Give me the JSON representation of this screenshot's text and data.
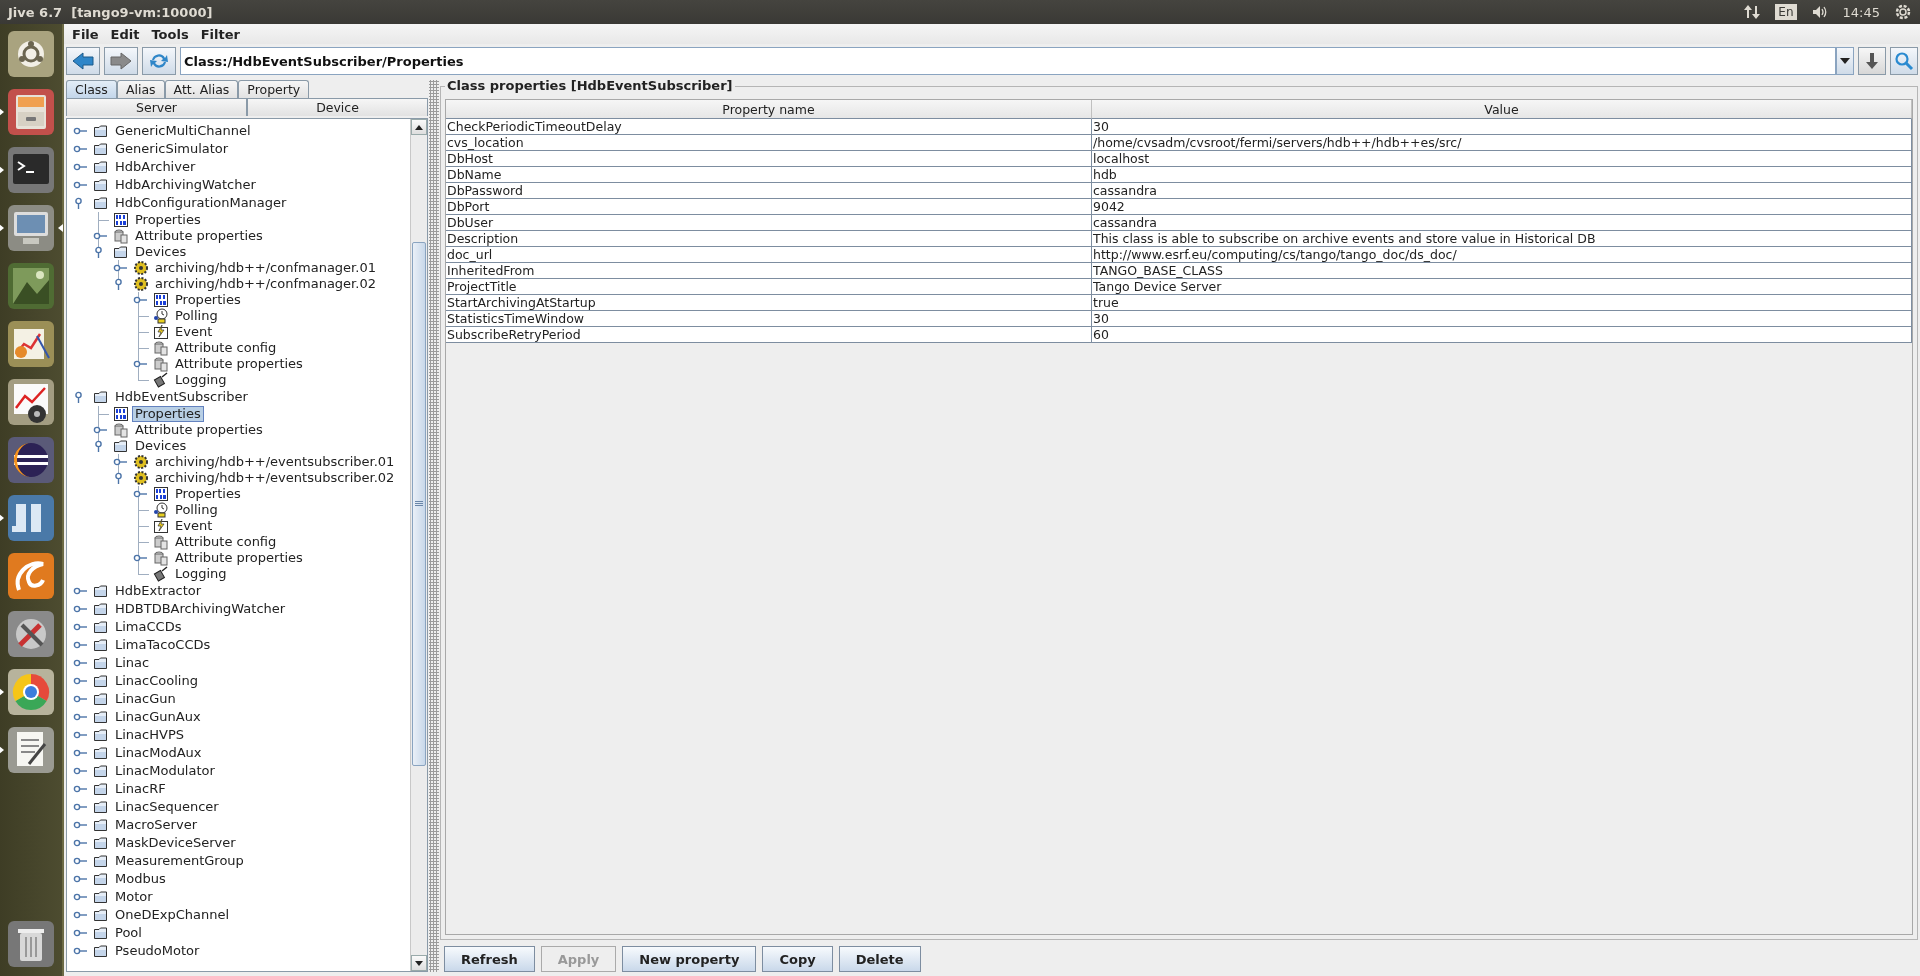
{
  "window": {
    "title": "Jive 6.7  [tango9-vm:10000]"
  },
  "panel": {
    "keyboard_layout": "En",
    "clock": "14:45"
  },
  "launcher": [
    {
      "kind": "ubuntu",
      "running": false,
      "focused": false
    },
    {
      "kind": "files",
      "running": true,
      "focused": false
    },
    {
      "kind": "terminal",
      "running": true,
      "focused": false
    },
    {
      "kind": "monitor",
      "running": true,
      "focused": true
    },
    {
      "kind": "photo",
      "running": false,
      "focused": false
    },
    {
      "kind": "chart",
      "running": false,
      "focused": false
    },
    {
      "kind": "media",
      "running": false,
      "focused": false
    },
    {
      "kind": "eclipse",
      "running": false,
      "focused": false
    },
    {
      "kind": "jive",
      "running": true,
      "focused": false
    },
    {
      "kind": "swirl",
      "running": false,
      "focused": false
    },
    {
      "kind": "tools",
      "running": false,
      "focused": false
    },
    {
      "kind": "browser",
      "running": true,
      "focused": false
    },
    {
      "kind": "editor",
      "running": true,
      "focused": false
    },
    {
      "kind": "trash",
      "running": false,
      "focused": false
    }
  ],
  "menu": [
    "File",
    "Edit",
    "Tools",
    "Filter"
  ],
  "nav_buttons": [
    {
      "kind": "back",
      "disabled": false
    },
    {
      "kind": "forward",
      "disabled": true
    },
    {
      "kind": "refresh",
      "disabled": false
    }
  ],
  "address": "Class:/HdbEventSubscriber/Properties",
  "tabs": {
    "top_row": [
      {
        "label": "Class",
        "selected": true
      },
      {
        "label": "Alias",
        "selected": false
      },
      {
        "label": "Att. Alias",
        "selected": false
      },
      {
        "label": "Property",
        "selected": false
      }
    ],
    "bottom_row": [
      {
        "label": "Server",
        "selected": false
      },
      {
        "label": "Device",
        "selected": false
      }
    ]
  },
  "tree": {
    "items": [
      {
        "label": "GenericMultiChannel",
        "kind": "folder",
        "expanded": false,
        "selected": false
      },
      {
        "label": "GenericSimulator",
        "kind": "folder",
        "expanded": false,
        "selected": false
      },
      {
        "label": "HdbArchiver",
        "kind": "folder",
        "expanded": false,
        "selected": false
      },
      {
        "label": "HdbArchivingWatcher",
        "kind": "folder",
        "expanded": false,
        "selected": false
      },
      {
        "label": "HdbConfigurationManager",
        "kind": "folder",
        "expanded": true,
        "selected": false,
        "children": [
          {
            "label": "Properties",
            "kind": "properties",
            "selected": false
          },
          {
            "label": "Attribute properties",
            "kind": "attributes",
            "expanded": false,
            "selected": false
          },
          {
            "label": "Devices",
            "kind": "folder",
            "expanded": true,
            "selected": false,
            "children": [
              {
                "label": "archiving/hdb++/confmanager.01",
                "kind": "device",
                "expanded": false,
                "selected": false
              },
              {
                "label": "archiving/hdb++/confmanager.02",
                "kind": "device",
                "expanded": true,
                "selected": false,
                "children": [
                  {
                    "label": "Properties",
                    "kind": "properties",
                    "expanded": false,
                    "selected": false
                  },
                  {
                    "label": "Polling",
                    "kind": "polling",
                    "selected": false
                  },
                  {
                    "label": "Event",
                    "kind": "event",
                    "selected": false
                  },
                  {
                    "label": "Attribute config",
                    "kind": "attributes",
                    "selected": false
                  },
                  {
                    "label": "Attribute properties",
                    "kind": "attributes",
                    "expanded": false,
                    "selected": false
                  },
                  {
                    "label": "Logging",
                    "kind": "logging",
                    "selected": false
                  }
                ]
              }
            ]
          }
        ]
      },
      {
        "label": "HdbEventSubscriber",
        "kind": "folder",
        "expanded": true,
        "selected": false,
        "children": [
          {
            "label": "Properties",
            "kind": "properties",
            "selected": true
          },
          {
            "label": "Attribute properties",
            "kind": "attributes",
            "expanded": false,
            "selected": false
          },
          {
            "label": "Devices",
            "kind": "folder",
            "expanded": true,
            "selected": false,
            "children": [
              {
                "label": "archiving/hdb++/eventsubscriber.01",
                "kind": "device",
                "expanded": false,
                "selected": false
              },
              {
                "label": "archiving/hdb++/eventsubscriber.02",
                "kind": "device",
                "expanded": true,
                "selected": false,
                "children": [
                  {
                    "label": "Properties",
                    "kind": "properties",
                    "expanded": false,
                    "selected": false
                  },
                  {
                    "label": "Polling",
                    "kind": "polling",
                    "selected": false
                  },
                  {
                    "label": "Event",
                    "kind": "event",
                    "selected": false
                  },
                  {
                    "label": "Attribute config",
                    "kind": "attributes",
                    "selected": false
                  },
                  {
                    "label": "Attribute properties",
                    "kind": "attributes",
                    "expanded": false,
                    "selected": false
                  },
                  {
                    "label": "Logging",
                    "kind": "logging",
                    "selected": false
                  }
                ]
              }
            ]
          }
        ]
      },
      {
        "label": "HdbExtractor",
        "kind": "folder",
        "expanded": false,
        "selected": false
      },
      {
        "label": "HDBTDBArchivingWatcher",
        "kind": "folder",
        "expanded": false,
        "selected": false
      },
      {
        "label": "LimaCCDs",
        "kind": "folder",
        "expanded": false,
        "selected": false
      },
      {
        "label": "LimaTacoCCDs",
        "kind": "folder",
        "expanded": false,
        "selected": false
      },
      {
        "label": "Linac",
        "kind": "folder",
        "expanded": false,
        "selected": false
      },
      {
        "label": "LinacCooling",
        "kind": "folder",
        "expanded": false,
        "selected": false
      },
      {
        "label": "LinacGun",
        "kind": "folder",
        "expanded": false,
        "selected": false
      },
      {
        "label": "LinacGunAux",
        "kind": "folder",
        "expanded": false,
        "selected": false
      },
      {
        "label": "LinacHVPS",
        "kind": "folder",
        "expanded": false,
        "selected": false
      },
      {
        "label": "LinacModAux",
        "kind": "folder",
        "expanded": false,
        "selected": false
      },
      {
        "label": "LinacModulator",
        "kind": "folder",
        "expanded": false,
        "selected": false
      },
      {
        "label": "LinacRF",
        "kind": "folder",
        "expanded": false,
        "selected": false
      },
      {
        "label": "LinacSequencer",
        "kind": "folder",
        "expanded": false,
        "selected": false
      },
      {
        "label": "MacroServer",
        "kind": "folder",
        "expanded": false,
        "selected": false
      },
      {
        "label": "MaskDeviceServer",
        "kind": "folder",
        "expanded": false,
        "selected": false
      },
      {
        "label": "MeasurementGroup",
        "kind": "folder",
        "expanded": false,
        "selected": false
      },
      {
        "label": "Modbus",
        "kind": "folder",
        "expanded": false,
        "selected": false
      },
      {
        "label": "Motor",
        "kind": "folder",
        "expanded": false,
        "selected": false
      },
      {
        "label": "OneDExpChannel",
        "kind": "folder",
        "expanded": false,
        "selected": false
      },
      {
        "label": "Pool",
        "kind": "folder",
        "expanded": false,
        "selected": false
      },
      {
        "label": "PseudoMotor",
        "kind": "folder",
        "expanded": false,
        "selected": false
      }
    ]
  },
  "properties": {
    "title": "Class properties [HdbEventSubscriber]",
    "columns": [
      "Property name",
      "Value"
    ],
    "rows": [
      [
        "CheckPeriodicTimeoutDelay",
        "30"
      ],
      [
        "cvs_location",
        "/home/cvsadm/cvsroot/fermi/servers/hdb++/hdb++es/src/"
      ],
      [
        "DbHost",
        "localhost"
      ],
      [
        "DbName",
        "hdb"
      ],
      [
        "DbPassword",
        "cassandra"
      ],
      [
        "DbPort",
        "9042"
      ],
      [
        "DbUser",
        "cassandra"
      ],
      [
        "Description",
        "This class is able to subscribe on archive events and store value in Historical DB"
      ],
      [
        "doc_url",
        "http://www.esrf.eu/computing/cs/tango/tango_doc/ds_doc/"
      ],
      [
        "InheritedFrom",
        "TANGO_BASE_CLASS"
      ],
      [
        "ProjectTitle",
        "Tango Device Server"
      ],
      [
        "StartArchivingAtStartup",
        "true"
      ],
      [
        "StatisticsTimeWindow",
        "30"
      ],
      [
        "SubscribeRetryPeriod",
        "60"
      ]
    ]
  },
  "buttons": [
    {
      "label": "Refresh",
      "disabled": false
    },
    {
      "label": "Apply",
      "disabled": true
    },
    {
      "label": "New property",
      "disabled": false
    },
    {
      "label": "Copy",
      "disabled": false
    },
    {
      "label": "Delete",
      "disabled": false
    }
  ]
}
